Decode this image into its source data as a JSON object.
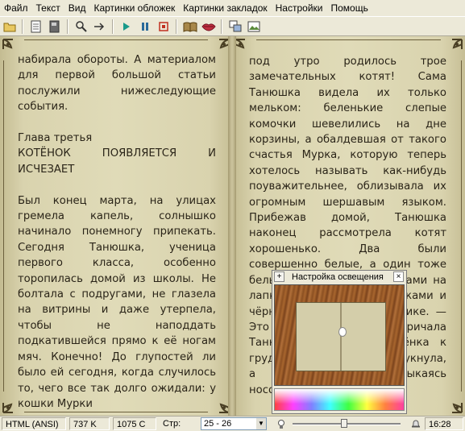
{
  "menu": [
    "Файл",
    "Текст",
    "Вид",
    "Картинки обложек",
    "Картинки закладок",
    "Настройки",
    "Помощь"
  ],
  "left_page": {
    "paragraphs": [
      "набирала обороты. А материалом для первой большой статьи послужили нижеследующие события.",
      "",
      "Глава третья",
      "КОТЁНОК ПОЯВЛЯЕТСЯ И ИСЧЕЗАЕТ",
      "",
      "Был конец марта, на улицах гремела капель, солнышко начинало понемногу припекать. Сегодня Танюшка, ученица первого класса, особенно торопилась домой из школы. Не болтала с подругами, не глазела на витрины и даже утерпела, чтобы не наподдать подкатившейся прямо к её ногам мяч. Конечно! До глупостей ли было ей сегодня, когда случилось то, чего все так долго ожидали: у кошки Мурки"
    ]
  },
  "right_page": {
    "text": "под утро родилось трое замечательных котят! Сама Танюшка видела их только мельком: беленькие слепые комочки шевелились на дне корзины, а обалдевшая от такого счастья Мурка, которую теперь хотелось называть как-нибудь поуважительнее, облизывала их огромным шершавым языком. Прибежав домой, Танюшка наконец рассмотрела котят хорошенько. Два были совершенно белые, а один тоже белый, но с черными пятнами на лапках, и чёрными кисточками и чёрной полоской на хвостике. — Это Ступсик, — тут же закричала Танюшка, прижимая котёнка к груди. Мурка тревожно мяукнула, а котёнок запищал, тыкаясь носом в ладошку. И ещё"
  },
  "popup": {
    "pin": "+",
    "title": "Настройка освещения",
    "close": "×"
  },
  "status": {
    "encoding": "HTML (ANSI)",
    "size": "737 K",
    "chars": "1075 C",
    "pages_label": "Стр:",
    "pages_value": "25 - 26",
    "time": "16:28"
  },
  "colors": {
    "page": "#e0dbb8",
    "text": "#2a2418",
    "ui": "#ece9d8"
  }
}
